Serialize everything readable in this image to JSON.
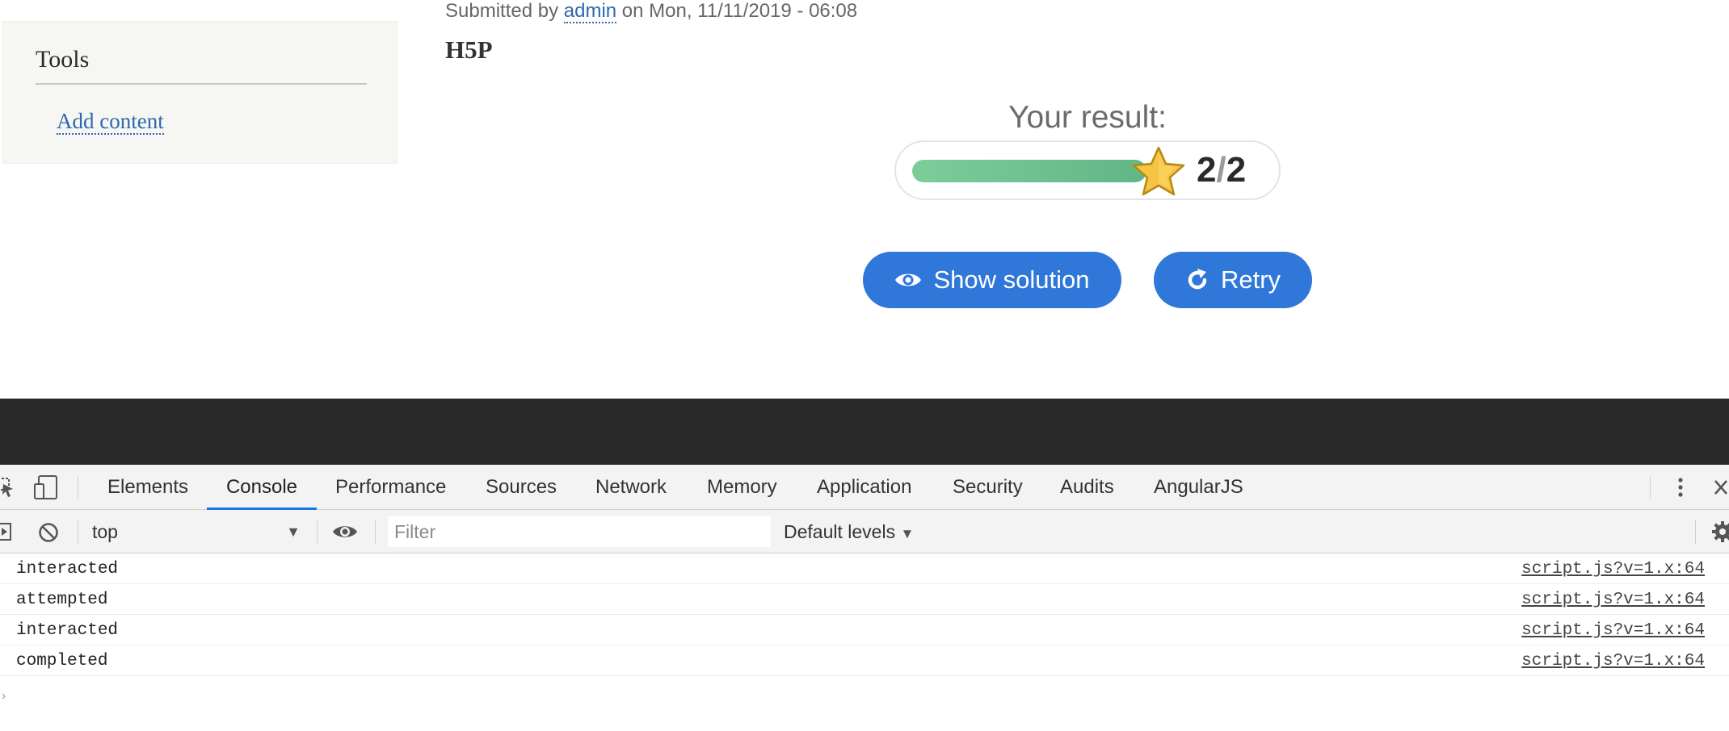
{
  "sidebar": {
    "title": "Tools",
    "link_label": "Add content"
  },
  "node": {
    "submitted_prefix": "Submitted by",
    "author": "admin",
    "submitted_suffix": "on Mon, 11/11/2019 - 06:08",
    "title": "H5P"
  },
  "result": {
    "label": "Your result:",
    "score": "2",
    "separator": "/",
    "max_score": "2",
    "fill_percent": 100,
    "star_icon": "star-icon",
    "colors": {
      "fill": "#6cc08f",
      "star": "#f6c343",
      "button": "#2f77d9"
    }
  },
  "buttons": {
    "show_solution": "Show solution",
    "retry": "Retry",
    "show_solution_icon": "eye-icon",
    "retry_icon": "retry-icon"
  },
  "devtools": {
    "tabs": [
      {
        "label": "Elements",
        "active": false
      },
      {
        "label": "Console",
        "active": true
      },
      {
        "label": "Performance",
        "active": false
      },
      {
        "label": "Sources",
        "active": false
      },
      {
        "label": "Network",
        "active": false
      },
      {
        "label": "Memory",
        "active": false
      },
      {
        "label": "Application",
        "active": false
      },
      {
        "label": "Security",
        "active": false
      },
      {
        "label": "Audits",
        "active": false
      },
      {
        "label": "AngularJS",
        "active": false
      }
    ],
    "toolbar": {
      "context": "top",
      "filter_placeholder": "Filter",
      "levels": "Default levels"
    },
    "console": [
      {
        "message": "interacted",
        "source": "script.js?v=1.x:64"
      },
      {
        "message": "attempted",
        "source": "script.js?v=1.x:64"
      },
      {
        "message": "interacted",
        "source": "script.js?v=1.x:64"
      },
      {
        "message": "completed",
        "source": "script.js?v=1.x:64"
      }
    ],
    "prompt": "›"
  }
}
